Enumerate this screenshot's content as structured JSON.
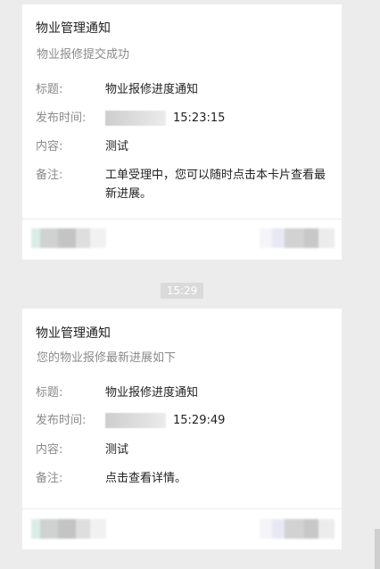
{
  "messages": [
    {
      "title": "物业管理通知",
      "subtitle": "物业报修提交成功",
      "fields": {
        "subject_label": "标题:",
        "subject_value": "物业报修进度通知",
        "time_label": "发布时间:",
        "time_value": "15:23:15",
        "content_label": "内容:",
        "content_value": "测试",
        "note_label": "备注:",
        "note_value": "工单受理中，您可以随时点击本卡片查看最新进展。"
      }
    },
    {
      "title": "物业管理通知",
      "subtitle": "您的物业报修最新进展如下",
      "fields": {
        "subject_label": "标题:",
        "subject_value": "物业报修进度通知",
        "time_label": "发布时间:",
        "time_value": "15:29:49",
        "content_label": "内容:",
        "content_value": "测试",
        "note_label": "备注:",
        "note_value": "点击查看详情。"
      }
    }
  ],
  "divider_time": "15:29",
  "colors": {
    "page_background": "#ececec",
    "card_background": "#ffffff",
    "title_text": "#222222",
    "secondary_text": "#8a8a8a",
    "timestamp_pill": "#dadada"
  }
}
